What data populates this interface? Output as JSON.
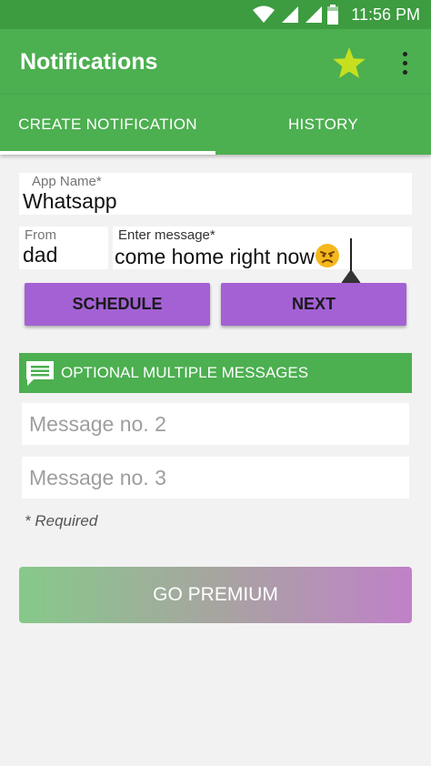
{
  "status_bar": {
    "time": "11:56 PM"
  },
  "app_bar": {
    "title": "Notifications"
  },
  "tabs": [
    {
      "label": "CREATE NOTIFICATION",
      "active": true
    },
    {
      "label": "HISTORY",
      "active": false
    }
  ],
  "form": {
    "app_name": {
      "label": "App Name*",
      "value": "Whatsapp"
    },
    "from": {
      "label": "From",
      "value": "dad"
    },
    "message": {
      "label": "Enter message*",
      "value": "come home right now",
      "emoji": "angry-face"
    }
  },
  "buttons": {
    "schedule": "SCHEDULE",
    "next": "NEXT"
  },
  "optional": {
    "title": "OPTIONAL MULTIPLE MESSAGES",
    "message2_placeholder": "Message no. 2",
    "message3_placeholder": "Message no. 3"
  },
  "required_note": "*  Required",
  "premium_label": "GO PREMIUM",
  "colors": {
    "primary": "#4caf50",
    "primary_dark": "#3d9b40",
    "accent": "#a461d4",
    "star": "#c6e01f"
  }
}
